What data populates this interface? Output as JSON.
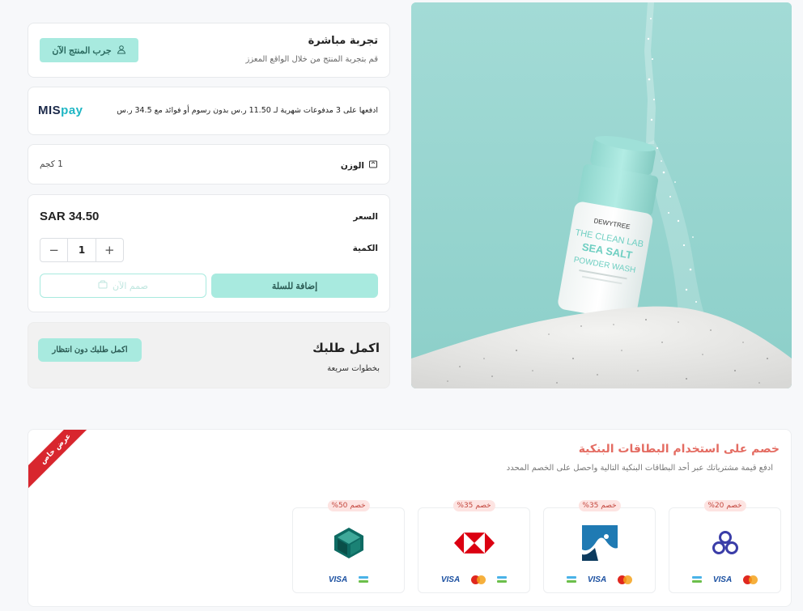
{
  "live_try": {
    "title": "تجربة مباشرة",
    "subtitle": "قم بتجربة المنتج من خلال الواقع المعزز",
    "button": "جرب المنتج الآن",
    "icon": "user-icon"
  },
  "mispay": {
    "logo_mis": "MIS",
    "logo_pay": "pay",
    "text": "ادفعها على 3 مدفوعات شهرية لـ 11.50 ر.س بدون رسوم أو فوائد مع 34.5 ر.س"
  },
  "weight": {
    "label": "الوزن",
    "value": "1 كجم",
    "icon": "scale-icon"
  },
  "purchase": {
    "price_label": "السعر",
    "price_value": "SAR 34.50",
    "quantity_label": "الكمية",
    "quantity": "1",
    "minus": "−",
    "plus": "+",
    "add_to_cart": "إضافة للسلة",
    "design_now": "صمم الآن"
  },
  "checkout": {
    "title": "اكمل طلبك",
    "subtitle": "بخطوات سريعة",
    "button": "اكمل طلبك دون انتظار"
  },
  "product_image": {
    "brand": "DEWYTREE",
    "line1": "THE CLEAN LAB",
    "line2": "SEA SALT",
    "line3": "POWDER WASH",
    "colors": {
      "background": "#9fd8d3",
      "bottle": "#ffffff",
      "cap": "#9fe0d8"
    }
  },
  "bank_offers": {
    "ribbon": "عرض خاص",
    "title": "خصم على استخدام البطاقات البنكية",
    "subtitle": "ادفع قيمة مشترياتك عبر أحد البطاقات البنكية التالية واحصل على الخصم المحدد",
    "visa_label": "VISA",
    "banks": [
      {
        "discount": "خصم 20%",
        "logo": "alinma-bank-logo",
        "color": "#3a3da8"
      },
      {
        "discount": "خصم 35%",
        "logo": "bank-albilad-logo",
        "color": "#1a6f9c"
      },
      {
        "discount": "خصم 35%",
        "logo": "sab-hsbc-logo",
        "color": "#db0011"
      },
      {
        "discount": "خصم 50%",
        "logo": "saudi-national-bank-logo",
        "color": "#0e6b63"
      }
    ]
  }
}
